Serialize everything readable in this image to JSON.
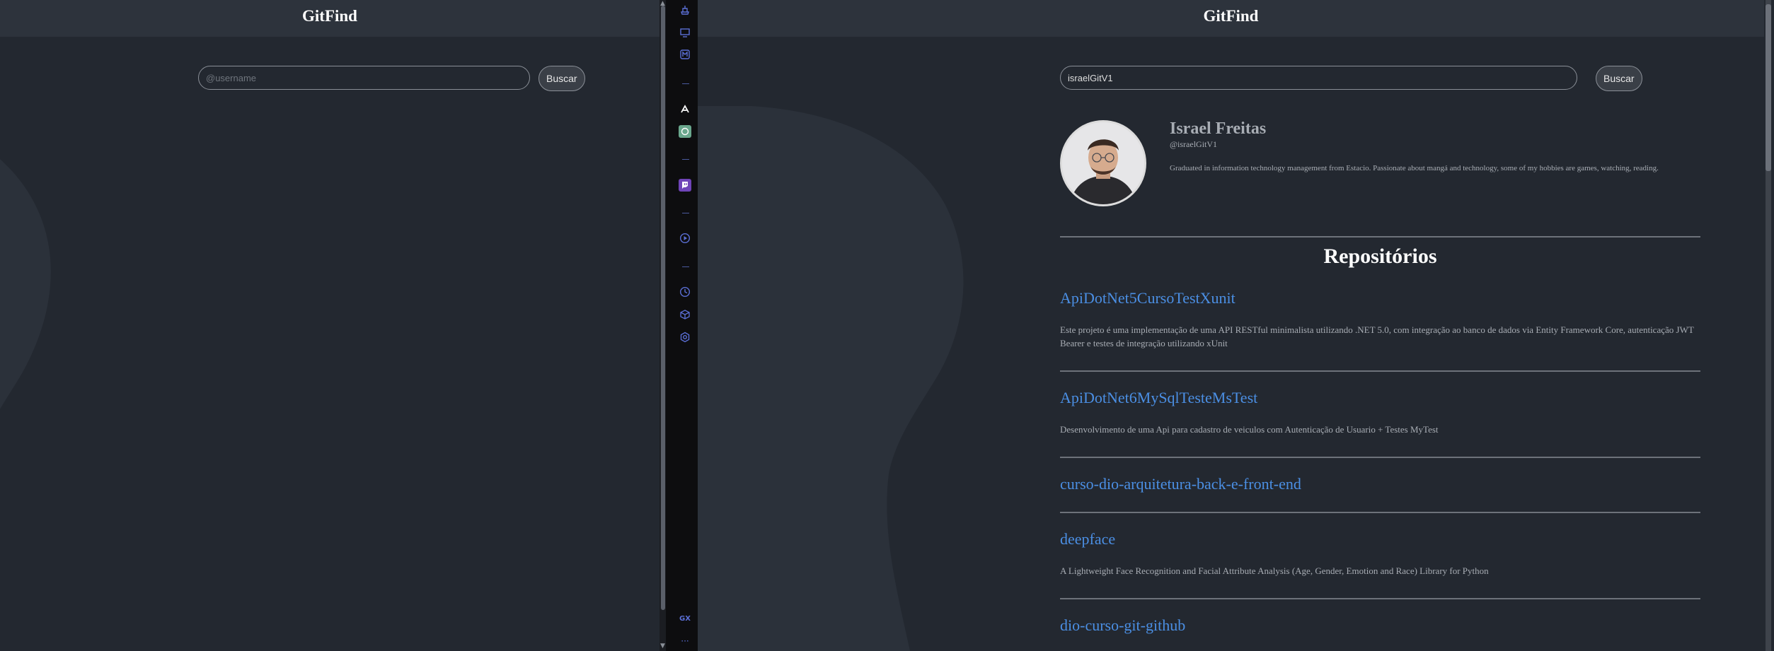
{
  "left_pane": {
    "title": "GitFind",
    "search": {
      "placeholder": "@username",
      "value": ""
    },
    "search_button": "Buscar"
  },
  "right_pane": {
    "title": "GitFind",
    "search": {
      "placeholder": "@username",
      "value": "israelGitV1"
    },
    "search_button": "Buscar",
    "profile": {
      "name": "Israel Freitas",
      "login": "@israelGitV1",
      "bio": "Graduated in information technology management from Estacio. Passionate about mangá and technology, some of my hobbies are games, watching, reading."
    },
    "repos_heading": "Repositórios",
    "repos": [
      {
        "name": "ApiDotNet5CursoTestXunit",
        "description": "Este projeto é uma implementação de uma API RESTful minimalista utilizando .NET 5.0, com integração ao banco de dados via Entity Framework Core, autenticação JWT Bearer e testes de integração utilizando xUnit"
      },
      {
        "name": "ApiDotNet6MySqlTesteMsTest",
        "description": "Desenvolvimento de uma Api para cadastro de veiculos com Autenticação de Usuario + Testes MyTest"
      },
      {
        "name": "curso-dio-arquitetura-back-e-front-end",
        "description": ""
      },
      {
        "name": "deepface",
        "description": "A Lightweight Face Recognition and Facial Attribute Analysis (Age, Gender, Emotion and Race) Library for Python"
      },
      {
        "name": "dio-curso-git-github",
        "description": ""
      }
    ]
  },
  "sidebar": {
    "icons": [
      "ship-icon",
      "monitor-icon",
      "mail-m-icon",
      "dash",
      "aria-icon",
      "chatgpt-icon",
      "dash",
      "twitch-icon",
      "dash",
      "play-icon",
      "dash",
      "clock-icon",
      "cube-icon",
      "settings-icon"
    ],
    "gx_label": "GX",
    "more_label": "···"
  },
  "colors": {
    "background": "#232830",
    "header": "#2d333c",
    "link": "#4b8fe4",
    "sidebar": "#0d0d0f",
    "sidebar_icon": "#5b6fd6"
  }
}
